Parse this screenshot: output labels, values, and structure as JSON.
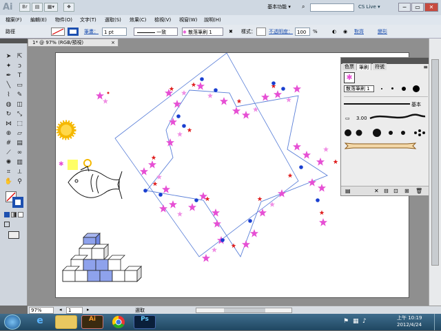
{
  "app": {
    "logo": "Ai",
    "workspace": "基本功能 ▾",
    "cslive": "CS Live ▾"
  },
  "window_controls": [
    "─",
    "▭",
    "✕"
  ],
  "menus": [
    "檔案(F)",
    "編輯(E)",
    "物件(O)",
    "文字(T)",
    "選取(S)",
    "效果(C)",
    "檢視(V)",
    "視窗(W)",
    "說明(H)"
  ],
  "control": {
    "path_label": "路徑",
    "stroke_label": "筆畫：",
    "stroke_weight": "1 pt",
    "dash_label": "一致",
    "brush_name": "散落筆刷 1",
    "style_label": "樣式：",
    "opacity_label": "不透明度：",
    "opacity_value": "100",
    "opacity_unit": "%",
    "align_label": "對齊",
    "transform_label": "變形"
  },
  "document": {
    "tab": "1* @ 97% (RGB/預視)",
    "tab_close": "×"
  },
  "panel": {
    "tabs": [
      "色票",
      "筆刷",
      "符號"
    ],
    "tooltip": "散落筆刷 1",
    "basic_label": "基本",
    "weight_label": "3.00"
  },
  "status": {
    "zoom": "97%",
    "page": "1",
    "tool_name": "選取"
  },
  "taskbar": {
    "time": "上午 10:19",
    "date": "2012/4/24",
    "apps": [
      "Ai",
      "Ps"
    ]
  },
  "icons": [
    "start-orb-icon",
    "ie-icon",
    "folder-icon",
    "chrome-icon",
    "selection-tool-icon",
    "direct-selection-tool-icon",
    "pen-tool-icon",
    "type-tool-icon",
    "hand-tool-icon",
    "zoom-tool-icon"
  ],
  "colors": {
    "accent": "#1d50b0",
    "star_pink": "#e64fd4",
    "path_blue": "#5a7fd8"
  }
}
